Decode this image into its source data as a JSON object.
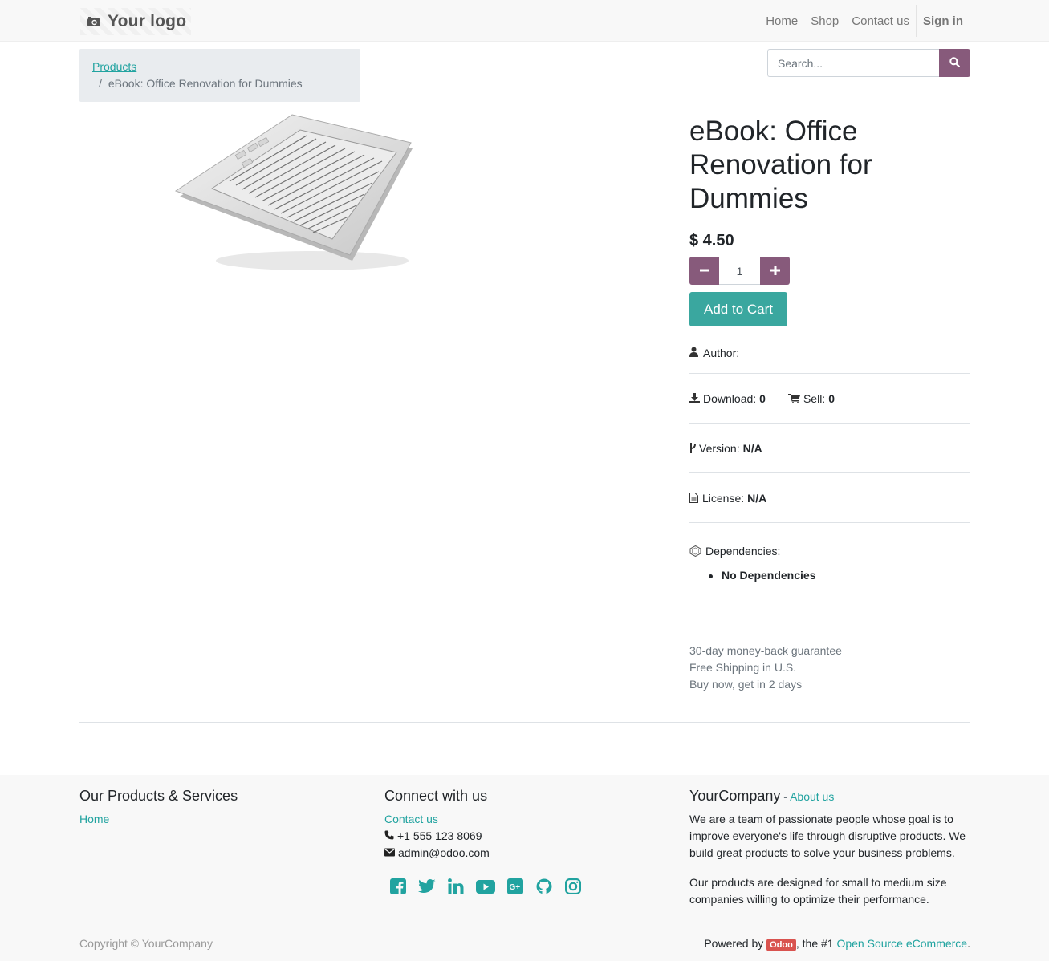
{
  "header": {
    "logo_text": "Your logo",
    "nav": [
      "Home",
      "Shop",
      "Contact us"
    ],
    "sign_in": "Sign in"
  },
  "breadcrumb": {
    "parent": "Products",
    "separator": "/",
    "current": "eBook: Office Renovation for Dummies"
  },
  "search": {
    "placeholder": "Search..."
  },
  "product": {
    "title": "eBook: Office Renovation for Dummies",
    "price": "$ 4.50",
    "quantity": "1",
    "add_to_cart": "Add to Cart",
    "author_label": "Author:",
    "download_label": "Download:",
    "download_value": "0",
    "sell_label": "Sell:",
    "sell_value": "0",
    "version_label": "Version:",
    "version_value": "N/A",
    "license_label": "License:",
    "license_value": "N/A",
    "dependencies_label": "Dependencies:",
    "dependencies": [
      "No Dependencies"
    ],
    "guarantees": [
      "30-day money-back guarantee",
      "Free Shipping in U.S.",
      "Buy now, get in 2 days"
    ]
  },
  "footer": {
    "products_heading": "Our Products & Services",
    "products_links": [
      "Home"
    ],
    "connect_heading": "Connect with us",
    "contact_link": "Contact us",
    "phone": "+1 555 123 8069",
    "email": "admin@odoo.com",
    "social_icons": [
      "facebook-icon",
      "twitter-icon",
      "linkedin-icon",
      "youtube-icon",
      "google-plus-icon",
      "github-icon",
      "instagram-icon"
    ],
    "company_heading": "YourCompany",
    "about_sep": " - ",
    "about_link": "About us",
    "about_p1": "We are a team of passionate people whose goal is to improve everyone's life through disruptive products. We build great products to solve your business problems.",
    "about_p2": "Our products are designed for small to medium size companies willing to optimize their performance.",
    "copyright": "Copyright © YourCompany",
    "powered_prefix": "Powered by ",
    "odoo_badge": "Odoo",
    "powered_mid": ", the #1 ",
    "powered_link": "Open Source eCommerce",
    "powered_suffix": "."
  },
  "colors": {
    "primary": "#875a7b",
    "accent": "#3aa79f",
    "link": "#21a3a0"
  }
}
